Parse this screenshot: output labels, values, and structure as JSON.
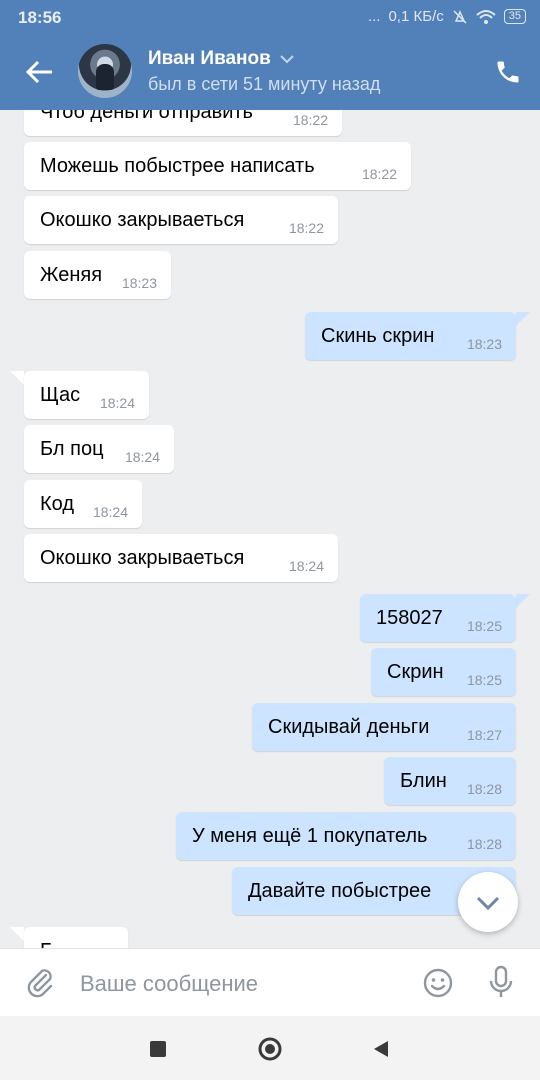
{
  "status": {
    "time": "18:56",
    "dots": "...",
    "speed": "0,1 КБ/с",
    "battery": "35"
  },
  "header": {
    "name": "Иван Иванов",
    "status": "был в сети 51 минуту назад"
  },
  "messages": [
    {
      "dir": "in",
      "text": "Чтоб деньги отправить",
      "time": "18:22"
    },
    {
      "dir": "in",
      "text": "Можешь побыстрее написать",
      "time": "18:22"
    },
    {
      "dir": "in",
      "text": "Окошко закрываеться",
      "time": "18:22"
    },
    {
      "dir": "in",
      "text": "Женяя",
      "time": "18:23"
    },
    {
      "dir": "out",
      "text": "Скинь скрин",
      "time": "18:23"
    },
    {
      "dir": "in",
      "text": "Щас",
      "time": "18:24"
    },
    {
      "dir": "in",
      "text": "Бл поц",
      "time": "18:24"
    },
    {
      "dir": "in",
      "text": "Код",
      "time": "18:24"
    },
    {
      "dir": "in",
      "text": "Окошко закрываеться",
      "time": "18:24"
    },
    {
      "dir": "out",
      "text": "158027",
      "time": "18:25"
    },
    {
      "dir": "out",
      "text": "Скрин",
      "time": "18:25"
    },
    {
      "dir": "out",
      "text": "Скидывай деньги",
      "time": "18:27"
    },
    {
      "dir": "out",
      "text": "Блин",
      "time": "18:28"
    },
    {
      "dir": "out",
      "text": "У меня ещё 1 покупатель",
      "time": "18:28"
    },
    {
      "dir": "out",
      "text": "Давайте побыстрее",
      "time": ""
    },
    {
      "dir": "in",
      "text": "Б",
      "time": ""
    }
  ],
  "composer": {
    "placeholder": "Ваше сообщение"
  },
  "icons": {
    "back": "arrow-left-icon",
    "phone": "phone-icon",
    "chevron": "chevron-down-icon",
    "clip": "paperclip-icon",
    "smile": "smile-icon",
    "mic": "microphone-icon",
    "scroll": "chevron-down-icon",
    "nav_recent": "square-icon",
    "nav_home": "circle-icon",
    "nav_back": "triangle-icon"
  },
  "colors": {
    "header": "#5181b8",
    "incoming": "#ffffff",
    "outgoing": "#cce4ff",
    "background": "#edeef0"
  }
}
